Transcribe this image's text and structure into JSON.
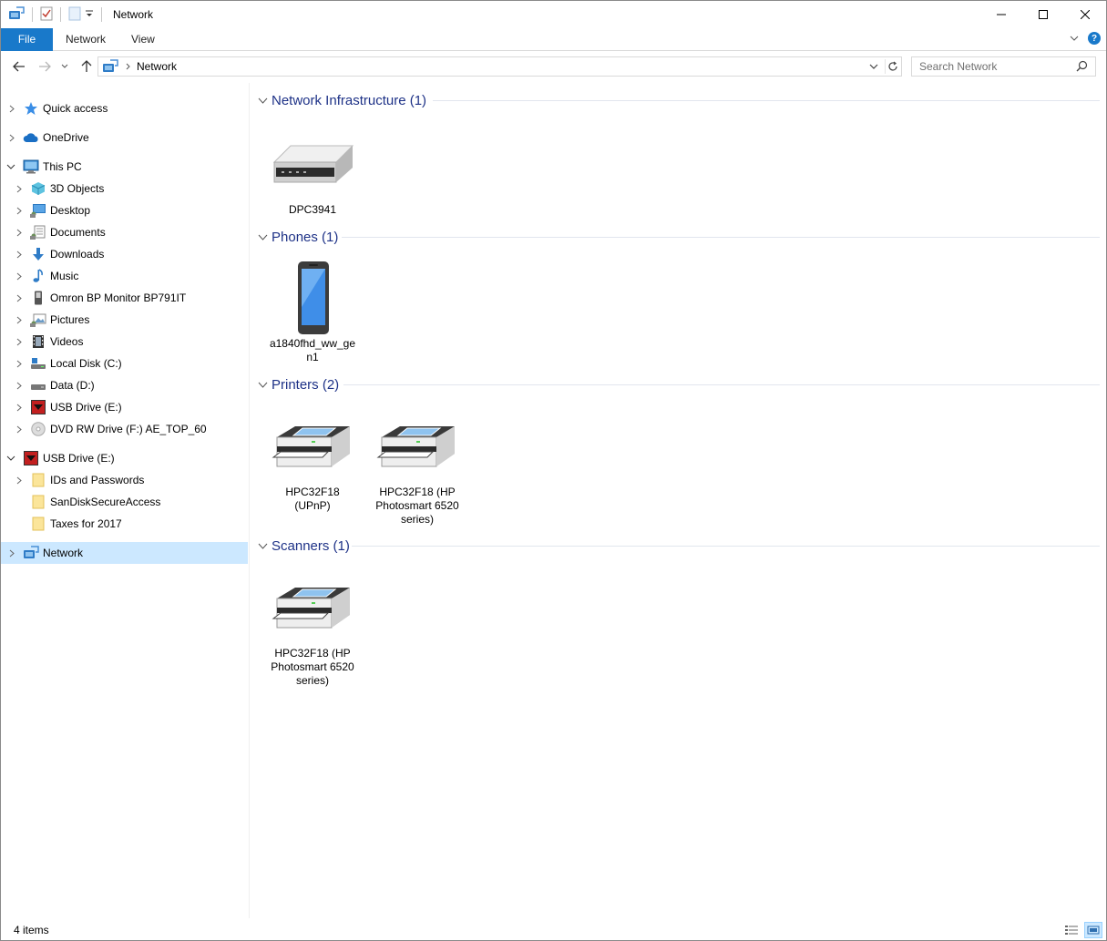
{
  "window": {
    "title": "Network"
  },
  "ribbon": {
    "file_tab": "File",
    "tabs": [
      "Network",
      "View"
    ]
  },
  "address": {
    "crumb": "Network",
    "search_placeholder": "Search Network"
  },
  "sidebar": {
    "quick_access": "Quick access",
    "onedrive": "OneDrive",
    "this_pc": "This PC",
    "pc_items": [
      "3D Objects",
      "Desktop",
      "Documents",
      "Downloads",
      "Music",
      "Omron BP Monitor BP791IT",
      "Pictures",
      "Videos",
      "Local Disk (C:)",
      "Data (D:)",
      "USB Drive (E:)",
      "DVD RW Drive (F:) AE_TOP_60"
    ],
    "usb_drive": "USB Drive (E:)",
    "usb_items": [
      "IDs and Passwords",
      "SanDiskSecureAccess",
      "Taxes for 2017"
    ],
    "network": "Network"
  },
  "groups": {
    "infrastructure": {
      "title": "Network Infrastructure (1)",
      "items": [
        "DPC3941"
      ]
    },
    "phones": {
      "title": "Phones (1)",
      "items": [
        "a1840fhd_ww_gen1"
      ]
    },
    "printers": {
      "title": "Printers (2)",
      "items": [
        "HPC32F18 (UPnP)",
        "HPC32F18 (HP Photosmart 6520 series)"
      ]
    },
    "scanners": {
      "title": "Scanners (1)",
      "items": [
        "HPC32F18 (HP Photosmart 6520 series)"
      ]
    }
  },
  "status": {
    "count": "4 items"
  },
  "colors": {
    "accent": "#1979ca",
    "selection": "#cce8ff",
    "group_title": "#1e3287"
  }
}
